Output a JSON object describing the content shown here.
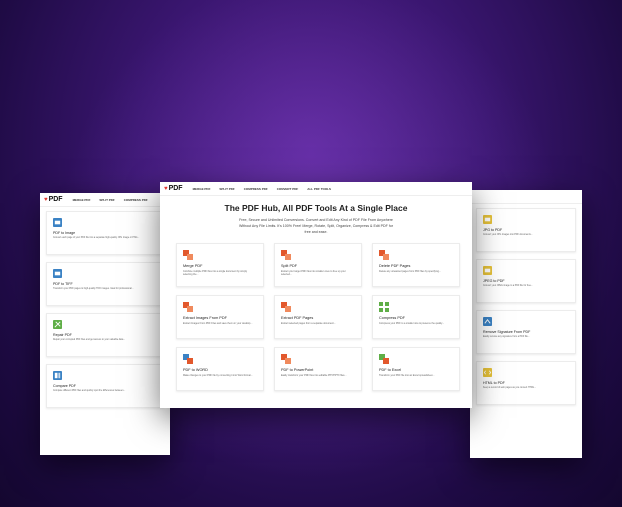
{
  "brand": {
    "logo_text": "PDF",
    "accent": "#e2342c"
  },
  "left_page": {
    "nav": [
      "MERGE PDF",
      "SPLIT PDF",
      "COMPRESS PDF"
    ],
    "cards": [
      {
        "title": "PDF to Image",
        "desc": "Convert each page of your PDF file into a separate high-quality JPG image or PNG...",
        "icon": "pdf-to-image-icon",
        "color": "#3b82c4"
      },
      {
        "title": "PDF to TIFF",
        "desc": "Transform your PDF pages to high-quality TIFF images. Ideal for professional...",
        "icon": "pdf-to-tiff-icon",
        "color": "#3b82c4"
      },
      {
        "title": "Repair PDF",
        "desc": "Repair your corrupted PDF files and get access to your valuable data...",
        "icon": "repair-icon",
        "color": "#5fae47"
      },
      {
        "title": "Compare PDF",
        "desc": "Compare different PDF files and quickly spot the differences between...",
        "icon": "compare-icon",
        "color": "#3b82c4"
      }
    ]
  },
  "center_page": {
    "nav": [
      "MERGE PDF",
      "SPLIT PDF",
      "COMPRESS PDF",
      "CONVERT PDF",
      "ALL PDF TOOLS"
    ],
    "hero": {
      "title": "The PDF Hub, All PDF Tools At a Single Place",
      "line1": "Free, Secure and Unlimited Conversions. Convert and Edit Any Kind of PDF File From Anywhere",
      "line2": "Without Any File Limits. It's 100% Free! Merge, Rotate, Split, Organize, Compress & Edit PDF for",
      "line3": "free and ease."
    },
    "cards": [
      {
        "title": "Merge PDF",
        "desc": "Combine multiple PDF files into a single document by simply selecting the...",
        "icon": "merge-icon",
        "color": "#e2582c"
      },
      {
        "title": "Split PDF",
        "desc": "Extract your target PDF files into smaller ones to free up your selected...",
        "icon": "split-icon",
        "color": "#e2582c"
      },
      {
        "title": "Delete PDF Pages",
        "desc": "Delete any unwanted pages from PDF files by specifying...",
        "icon": "delete-pages-icon",
        "color": "#e2582c"
      },
      {
        "title": "Extract Images From PDF",
        "desc": "Extract Images From PDF Files and save them on your desktop...",
        "icon": "extract-images-icon",
        "color": "#e2582c"
      },
      {
        "title": "Extract PDF Pages",
        "desc": "Extract selected pages from a separate document...",
        "icon": "extract-pages-icon",
        "color": "#e2582c"
      },
      {
        "title": "Compress PDF",
        "desc": "Compress your PDF to a smaller size & preserve the quality...",
        "icon": "compress-icon",
        "color": "#5fae47"
      },
      {
        "title": "PDF to WORD",
        "desc": "Make changes to your PDF file by converting it into Word format...",
        "icon": "pdf-to-word-icon",
        "color": "#3b82c4"
      },
      {
        "title": "PDF to PowerPoint",
        "desc": "Easily transform your PDF files into editable PPT/PPTX files...",
        "icon": "pdf-to-ppt-icon",
        "color": "#e2582c"
      },
      {
        "title": "PDF to Excel",
        "desc": "Transform your PDF file into an Excel spreadsheet...",
        "icon": "pdf-to-excel-icon",
        "color": "#5fae47"
      }
    ]
  },
  "right_page": {
    "cards": [
      {
        "title": "JPG to PDF",
        "desc": "Convert your JPG images into PDF documents...",
        "icon": "jpg-to-pdf-icon",
        "color": "#e6c23a"
      },
      {
        "title": "JPEG to PDF",
        "desc": "Convert your JPEG image to a PDF file for free...",
        "icon": "jpeg-to-pdf-icon",
        "color": "#e6c23a"
      },
      {
        "title": "Remove Signature From PDF",
        "desc": "Easily remove any signature from a PDF file...",
        "icon": "remove-signature-icon",
        "color": "#3b82c4"
      },
      {
        "title": "HTML to PDF",
        "desc": "Keep a record of web pages as you convert HTML...",
        "icon": "html-to-pdf-icon",
        "color": "#e6c23a"
      }
    ]
  }
}
